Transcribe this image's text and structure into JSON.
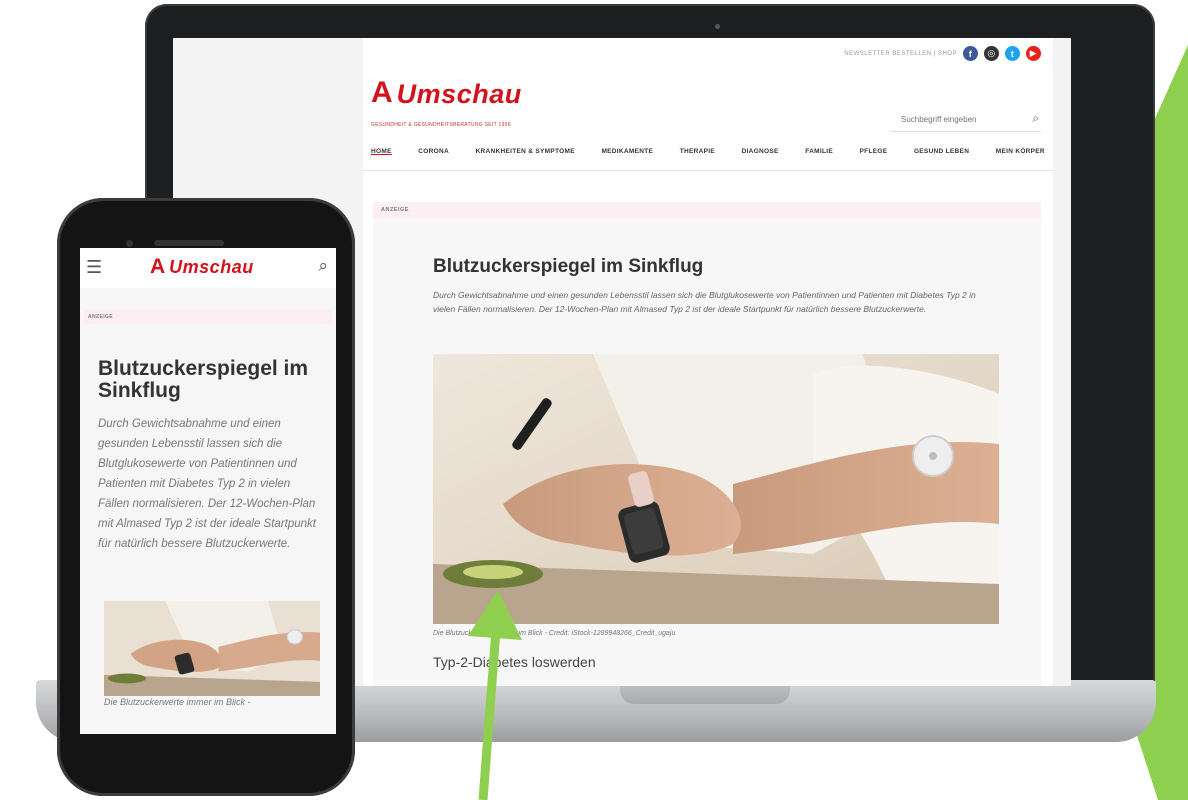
{
  "colors": {
    "brand_red": "#d2131d",
    "accent_green": "#8fcf4f",
    "laptop_frame": "#1d1e20"
  },
  "laptop": {
    "site": {
      "topbar_links": "NEWSLETTER BESTELLEN | SHOP",
      "social_icons": [
        "facebook-icon",
        "instagram-icon",
        "twitter-icon",
        "youtube-icon"
      ],
      "brand": "Umschau",
      "brand_super": "APOTHEKEN",
      "brand_tagline": "GESUNDHEIT & GESUNDHEITSBERATUNG SEIT 1956",
      "search_placeholder": "Suchbegriff eingeben",
      "nav": [
        "HOME",
        "CORONA",
        "KRANKHEITEN & SYMPTOME",
        "MEDIKAMENTE",
        "THERAPIE",
        "DIAGNOSE",
        "FAMILIE",
        "PFLEGE",
        "GESUND LEBEN",
        "MEIN KÖRPER"
      ],
      "tag": "ANZEIGE",
      "article": {
        "title": "Blutzuckerspiegel im Sinkflug",
        "lead": "Durch Gewichtsabnahme und einen gesunden Lebensstil lassen sich die Blutglukosewerte von Patientinnen und Patienten mit Diabetes Typ 2 in vielen Fällen normalisieren. Der 12-Wochen-Plan mit Almased Typ 2 ist der ideale Startpunkt für natürlich bessere Blutzuckerwerte.",
        "caption": "Die Blutzuckerwerte immer im Blick - Credit: iStock-1289948266_Credit_ugaju",
        "subhead": "Typ-2-Diabetes loswerden"
      }
    }
  },
  "phone": {
    "brand": "Umschau",
    "tag": "ANZEIGE",
    "title": "Blutzuckerspiegel im Sinkflug",
    "lead": "Durch Gewichtsabnahme und einen gesunden Lebensstil lassen sich die Blutglukosewerte von Patientinnen und Patienten mit Diabetes Typ 2 in vielen Fällen normalisieren. Der 12-Wochen-Plan mit Almased Typ 2 ist der ideale Startpunkt für natürlich bessere Blutzuckerwerte.",
    "caption": "Die Blutzuckerwerte immer im Blick -"
  }
}
